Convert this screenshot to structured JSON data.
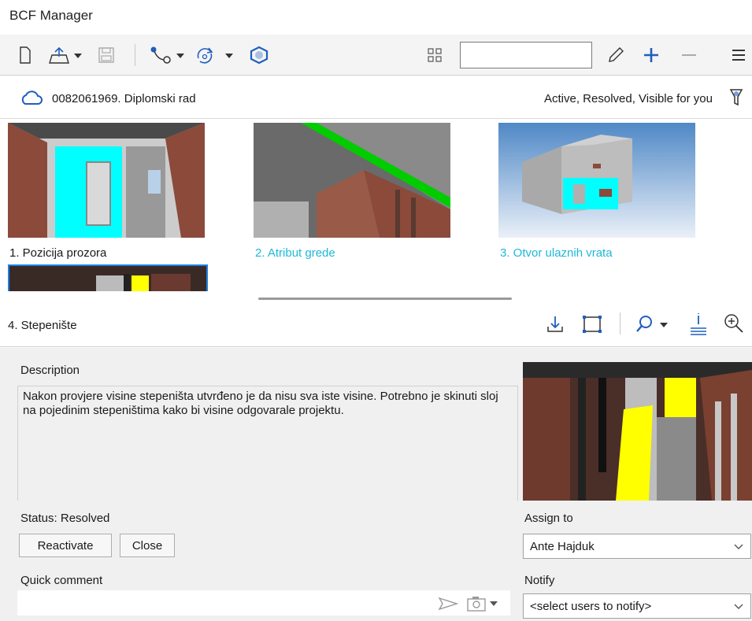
{
  "window": {
    "title": "BCF Manager"
  },
  "toolbar": {
    "icons": [
      "new-file-icon",
      "import-icon",
      "save-icon",
      "connect-icon",
      "sync-icon",
      "model-icon",
      "view-toggle-icon",
      "edit-icon",
      "add-icon",
      "remove-icon",
      "menu-icon"
    ],
    "search_value": ""
  },
  "project": {
    "name": "0082061969. Diplomski rad",
    "filter": "Active, Resolved, Visible for you"
  },
  "topics": [
    {
      "label": "1. Pozicija prozora",
      "color": "#1a1a1a"
    },
    {
      "label": "2. Atribut grede",
      "color": "#1fb8d8"
    },
    {
      "label": "3. Otvor ulaznih vrata",
      "color": "#1fb8d8"
    },
    {
      "label": "4. Stepenište",
      "color": "#1a1a1a"
    }
  ],
  "selected_topic": {
    "title": "4. Stepenište",
    "description_label": "Description",
    "description": "Nakon provjere visine stepeništa utvrđeno je da nisu sva iste visine. Potrebno je skinuti sloj na pojedinim stepeništima kako bi visine odgovarale projektu.",
    "status": "Status: Resolved",
    "reactivate_label": "Reactivate",
    "close_label": "Close",
    "quick_comment_label": "Quick comment",
    "quick_comment_value": "",
    "assign_label": "Assign to",
    "assign_value": "Ante Hajduk",
    "notify_label": "Notify",
    "notify_value": "<select users to notify>"
  },
  "colors": {
    "accent": "#1f5fbf",
    "link": "#1fb8d8",
    "highlight": "#00ffff",
    "yellow": "#ffff00",
    "brick": "#8b4a3a"
  }
}
